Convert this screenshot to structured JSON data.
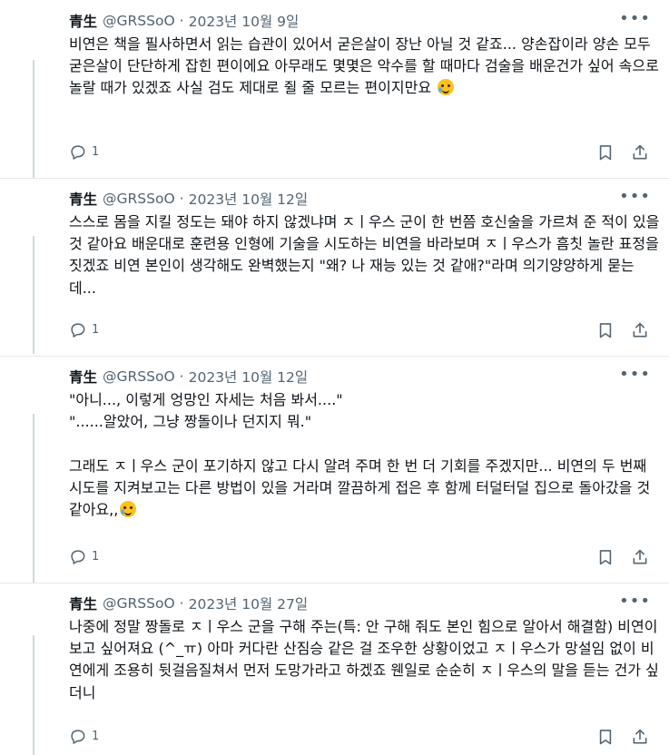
{
  "posts": [
    {
      "name": "青生",
      "handle": "@GRSSoO",
      "date": "2023년 10월 9일",
      "text": "비연은 책을 필사하면서 읽는 습관이 있어서 굳은살이 장난 아닐 것 같죠... 양손잡이라 양손 모두 굳은살이 단단하게 잡힌 편이에요 아무래도 몇몇은 악수를 할 때마다 검술을 배운건가 싶어 속으로 놀랄 때가 있겠죠 사실 검도 제대로 쥘 줄 모르는 편이지만요",
      "emoji": "face-holding-back-tears",
      "reply_count": "1"
    },
    {
      "name": "青生",
      "handle": "@GRSSoO",
      "date": "2023년 10월 12일",
      "text": "스스로 몸을 지킬 정도는 돼야 하지 않겠냐며 ㅈㅣ우스 군이 한 번쯤 호신술을 가르쳐 준 적이 있을 것 같아요 배운대로 훈련용 인형에 기술을 시도하는 비연을 바라보며 ㅈㅣ우스가 흠칫 놀란 표정을 짓겠죠 비연 본인이 생각해도 완벽했는지 \"왜? 나 재능 있는 것 같애?\"라며 의기양양하게 묻는데...",
      "emoji": "",
      "reply_count": "1"
    },
    {
      "name": "青生",
      "handle": "@GRSSoO",
      "date": "2023년 10월 12일",
      "text": "\"아니..., 이렇게 엉망인 자세는 처음 봐서....\"\n\"......알았어, 그냥 짱돌이나 던지지 뭐.\"\n\n그래도 ㅈㅣ우스 군이 포기하지 않고 다시 알려 주며 한 번 더 기회를 주겠지만... 비연의 두 번째 시도를 지켜보고는 다른 방법이 있을 거라며 깔끔하게 접은 후 함께 터덜터덜 집으로 돌아갔을 것 같아요,,",
      "emoji": "face-holding-back-tears",
      "reply_count": "1"
    },
    {
      "name": "青生",
      "handle": "@GRSSoO",
      "date": "2023년 10월 27일",
      "text": "나중에 정말 짱돌로 ㅈㅣ우스 군을 구해 주는(특: 안 구해 줘도 본인 힘으로 알아서 해결함) 비연이 보고 싶어져요 (^_ㅠ) 아마 커다란 산짐승 같은 걸 조우한 상황이었고 ㅈㅣ우스가 망설임 없이 비연에게 조용히 뒷걸음질쳐서 먼저 도망가라고 하겠죠 웬일로 순순히 ㅈㅣ우스의 말을 듣는 건가 싶더니",
      "emoji": "",
      "reply_count": "1"
    }
  ],
  "icons": {
    "more": "more-dots-icon",
    "reply": "reply-bubble-icon",
    "bookmark": "bookmark-icon",
    "share": "share-icon"
  },
  "colors": {
    "text": "#0f1419",
    "muted": "#536471",
    "divider": "#e7e9ea",
    "thread_line": "#cfd9de"
  }
}
